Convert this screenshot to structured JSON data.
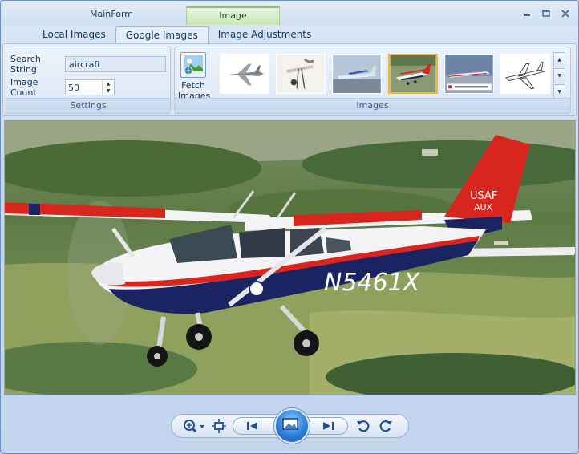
{
  "window": {
    "title": "MainForm",
    "context_tab": "Image",
    "controls": [
      "minimize-icon",
      "maximize-icon",
      "close-icon"
    ]
  },
  "tabs": [
    {
      "label": "Local Images",
      "active": false
    },
    {
      "label": "Google Images",
      "active": true
    },
    {
      "label": "Image Adjustments",
      "active": false
    }
  ],
  "settings": {
    "group_label": "Settings",
    "search_label": "Search String",
    "search_value": "aircraft",
    "count_label": "Image Count",
    "count_value": "50"
  },
  "images": {
    "group_label": "Images",
    "fetch_label_1": "Fetch",
    "fetch_label_2": "Images",
    "thumbnails": [
      {
        "name": "jet-fighter"
      },
      {
        "name": "antique-aircraft"
      },
      {
        "name": "blue-prop-plane"
      },
      {
        "name": "red-white-prop-plane",
        "selected": true
      },
      {
        "name": "airliner-ad"
      },
      {
        "name": "jet-line-drawing"
      }
    ]
  },
  "photo": {
    "tail_text_1": "USAF",
    "tail_text_2": "AUX",
    "registration": "N5461X",
    "colors": {
      "red": "#d8251e",
      "navy": "#1b2463",
      "white": "#f4f4f6"
    }
  },
  "toolbar": {
    "icons": [
      "zoom-icon",
      "fit-icon",
      "first-icon",
      "view-icon",
      "last-icon",
      "rotate-left-icon",
      "rotate-right-icon"
    ]
  }
}
